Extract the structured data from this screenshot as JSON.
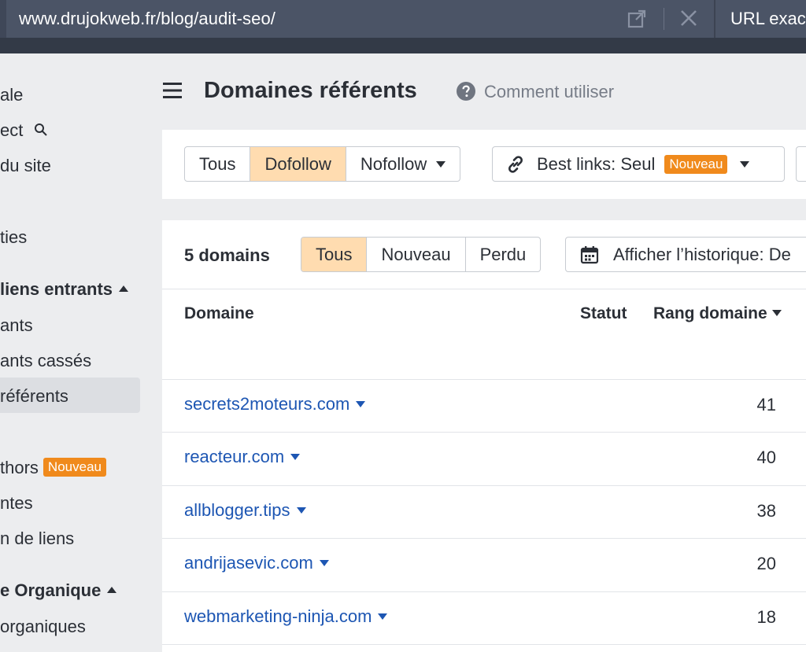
{
  "topbar": {
    "url": "www.drujokweb.fr/blog/audit-seo/",
    "mode_label": "URL exac"
  },
  "sidebar": {
    "items": [
      {
        "label": "ale"
      },
      {
        "label": "ect"
      },
      {
        "label": "du site"
      },
      {
        "label": "ties"
      },
      {
        "label": "liens entrants"
      },
      {
        "label": "ants"
      },
      {
        "label": "ants cassés"
      },
      {
        "label": "référents"
      },
      {
        "label": "thors",
        "badge": "Nouveau"
      },
      {
        "label": "ntes"
      },
      {
        "label": "n de liens"
      },
      {
        "label": "e Organique"
      },
      {
        "label": "organiques"
      }
    ]
  },
  "header": {
    "title": "Domaines référents",
    "help_label": "Comment utiliser"
  },
  "filters": {
    "link_type": [
      {
        "label": "Tous",
        "active": false
      },
      {
        "label": "Dofollow",
        "active": true
      },
      {
        "label": "Nofollow",
        "active": false
      }
    ],
    "best_links_label": "Best links: Seul",
    "best_links_badge": "Nouveau"
  },
  "results": {
    "count_label": "5 domains",
    "status_tabs": [
      {
        "label": "Tous",
        "active": true
      },
      {
        "label": "Nouveau",
        "active": false
      },
      {
        "label": "Perdu",
        "active": false
      }
    ],
    "history_label": "Afficher l’historique: De"
  },
  "table": {
    "columns": {
      "domain": "Domaine",
      "status": "Statut",
      "rank": "Rang domaine"
    },
    "rows": [
      {
        "domain": "secrets2moteurs.com",
        "rank": "41"
      },
      {
        "domain": "reacteur.com",
        "rank": "40"
      },
      {
        "domain": "allblogger.tips",
        "rank": "38"
      },
      {
        "domain": "andrijasevic.com",
        "rank": "20"
      },
      {
        "domain": "webmarketing-ninja.com",
        "rank": "18"
      }
    ]
  },
  "colors": {
    "topbar": "#4b5466",
    "accent_active": "#ffdcb0",
    "badge": "#f08a1c",
    "link": "#1d56b3"
  },
  "icons": [
    "external-link-icon",
    "close-icon",
    "hamburger-menu-icon",
    "help-circle-icon",
    "chain-link-icon",
    "calendar-icon",
    "search-icon"
  ]
}
